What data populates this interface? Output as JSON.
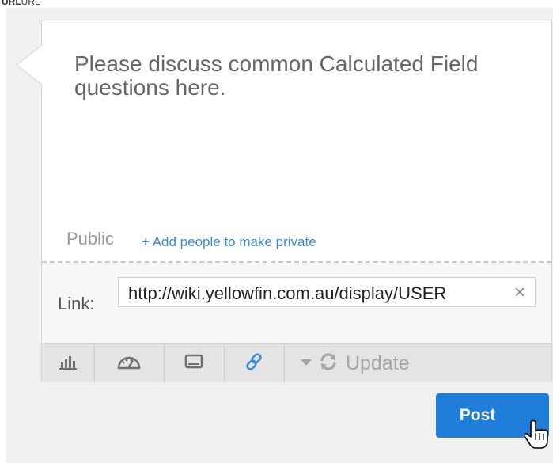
{
  "header": {
    "label_bold": "URL",
    "label": "URL"
  },
  "comment": {
    "message": "Please discuss common Calculated Field questions here.",
    "visibility": "Public",
    "add_people": "+ Add people to make private"
  },
  "link": {
    "label": "Link:",
    "value": "http://wiki.yellowfin.com.au/display/USER",
    "clear": "×"
  },
  "toolbar": {
    "update_label": "Update",
    "icons": [
      "bar-chart-icon",
      "dashboard-gauge-icon",
      "monitor-icon",
      "link-icon",
      "dropdown-arrow-icon",
      "refresh-icon"
    ]
  },
  "post": {
    "label": "Post"
  },
  "colors": {
    "accent": "#1e7ed9",
    "link": "#3a89d6",
    "toolbar": "#e4e4e4"
  }
}
